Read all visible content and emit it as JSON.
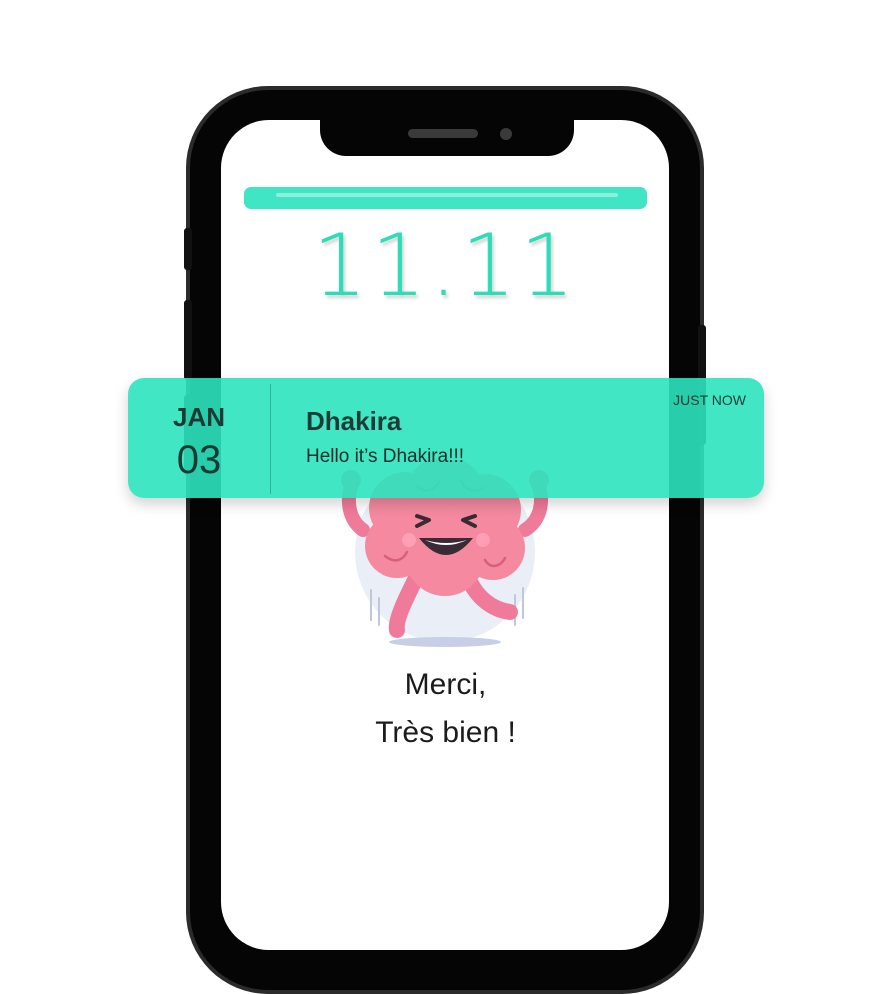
{
  "clock": {
    "time": "11.11"
  },
  "notification": {
    "month": "JAN",
    "day": "03",
    "sender": "Dhakira",
    "message": "Hello it’s Dhakira!!!",
    "time_label": "JUST NOW"
  },
  "screen_message": {
    "line1": "Merci,",
    "line2": "Très bien !"
  },
  "colors": {
    "accent": "#2ddcb8",
    "notification_bg": "#2ce4be",
    "brain_pink": "#f07a99"
  },
  "icons": [
    "brain-mascot-icon"
  ]
}
